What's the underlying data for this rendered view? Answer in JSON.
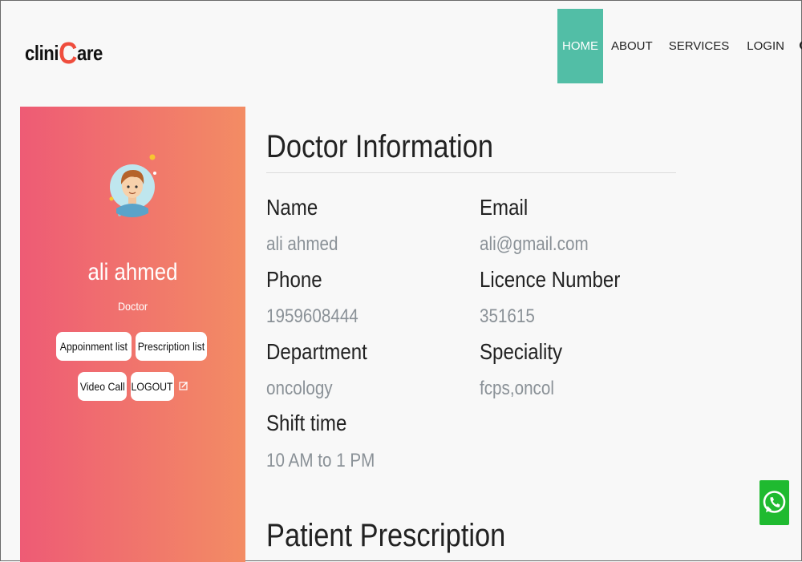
{
  "brand": {
    "logo_prefix": "clini",
    "logo_c": "C",
    "logo_suffix": "are",
    "accent_color": "#ef4d3d"
  },
  "nav": {
    "items": [
      {
        "label": "HOME",
        "active": true
      },
      {
        "label": "ABOUT",
        "active": false
      },
      {
        "label": "SERVICES",
        "active": false
      },
      {
        "label": "LOGIN",
        "active": false
      }
    ],
    "active_color": "#52bea6",
    "search_icon": "search-icon"
  },
  "sidebar": {
    "name": "ali ahmed",
    "role": "Doctor",
    "gradient_start": "#ee5b75",
    "gradient_end": "#f38c64",
    "buttons": {
      "appointment": "Appoinment list",
      "prescription": "Prescription list",
      "video": "Video Call",
      "logout": "LOGOUT"
    },
    "edit_icon": "edit-icon"
  },
  "doctor_info": {
    "title": "Doctor Information",
    "fields": [
      {
        "label": "Name",
        "value": "ali ahmed"
      },
      {
        "label": "Email",
        "value": "ali@gmail.com"
      },
      {
        "label": "Phone",
        "value": "1959608444"
      },
      {
        "label": "Licence Number",
        "value": "351615"
      },
      {
        "label": "Department",
        "value": "oncology"
      },
      {
        "label": "Speciality",
        "value": "fcps,oncol"
      },
      {
        "label": "Shift time",
        "value": "10 AM to 1 PM"
      }
    ]
  },
  "prescription": {
    "title": "Patient Prescription"
  },
  "whatsapp": {
    "icon": "whatsapp-icon",
    "color": "#1fba30"
  }
}
